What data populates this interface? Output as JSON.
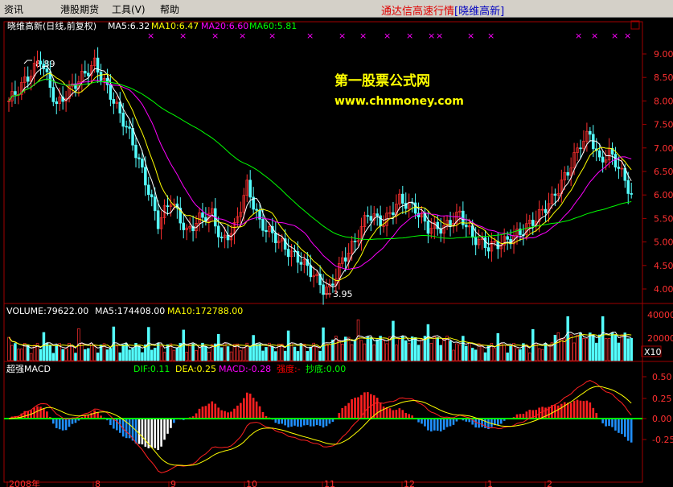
{
  "menu": {
    "items": [
      "资讯",
      "港股期货",
      "工具(V)",
      "帮助"
    ]
  },
  "app_title": {
    "brand": "通达信高速行情",
    "stock": "[晓维高新]"
  },
  "price_panel": {
    "stock_label": "晓维高新(日线,前复权)",
    "ma": [
      {
        "label": "MA5:6.32",
        "color": "#ffffff"
      },
      {
        "label": "MA10:6.47",
        "color": "#ffff00"
      },
      {
        "label": "MA20:6.60",
        "color": "#ff00ff"
      },
      {
        "label": "MA60:5.81",
        "color": "#00ff00"
      }
    ],
    "y_ticks": [
      "9.00",
      "8.50",
      "8.00",
      "7.50",
      "7.00",
      "6.50",
      "6.00",
      "5.50",
      "5.00",
      "4.50",
      "4.00"
    ],
    "high_label": "8.89",
    "low_label": "3.95"
  },
  "volume_panel": {
    "labels": [
      {
        "label": "VOLUME:79622.00",
        "color": "#ffffff"
      },
      {
        "label": "MA5:174408.00",
        "color": "#ffffff"
      },
      {
        "label": "MA10:172788.00",
        "color": "#ffff00"
      }
    ],
    "y_ticks": [
      "40000",
      "20000"
    ],
    "unit": "X10"
  },
  "macd_panel": {
    "name": "超强MACD",
    "labels": [
      {
        "label": "DIF:0.11",
        "color": "#00ff00"
      },
      {
        "label": "DEA:0.25",
        "color": "#ffff00"
      },
      {
        "label": "MACD:-0.28",
        "color": "#ff00ff"
      },
      {
        "label": "强度:-",
        "color": "#ff0000"
      },
      {
        "label": "抄底:0.00",
        "color": "#00ff00"
      }
    ],
    "y_ticks": [
      "0.50",
      "0.25",
      "0.00",
      "-0.25"
    ]
  },
  "x_axis": {
    "labels": [
      "2008年",
      "8",
      "9",
      "10",
      "11",
      "12",
      "1",
      "2"
    ]
  },
  "watermark": {
    "title": "第一股票公式网",
    "url": "www.chnmoney.com"
  },
  "colors": {
    "up": "#ff3030",
    "down": "#54ffff",
    "axis": "#a00000",
    "ma5": "#ffffff",
    "ma10": "#ffff00",
    "ma20": "#ff00ff",
    "ma60": "#00ff00"
  }
}
